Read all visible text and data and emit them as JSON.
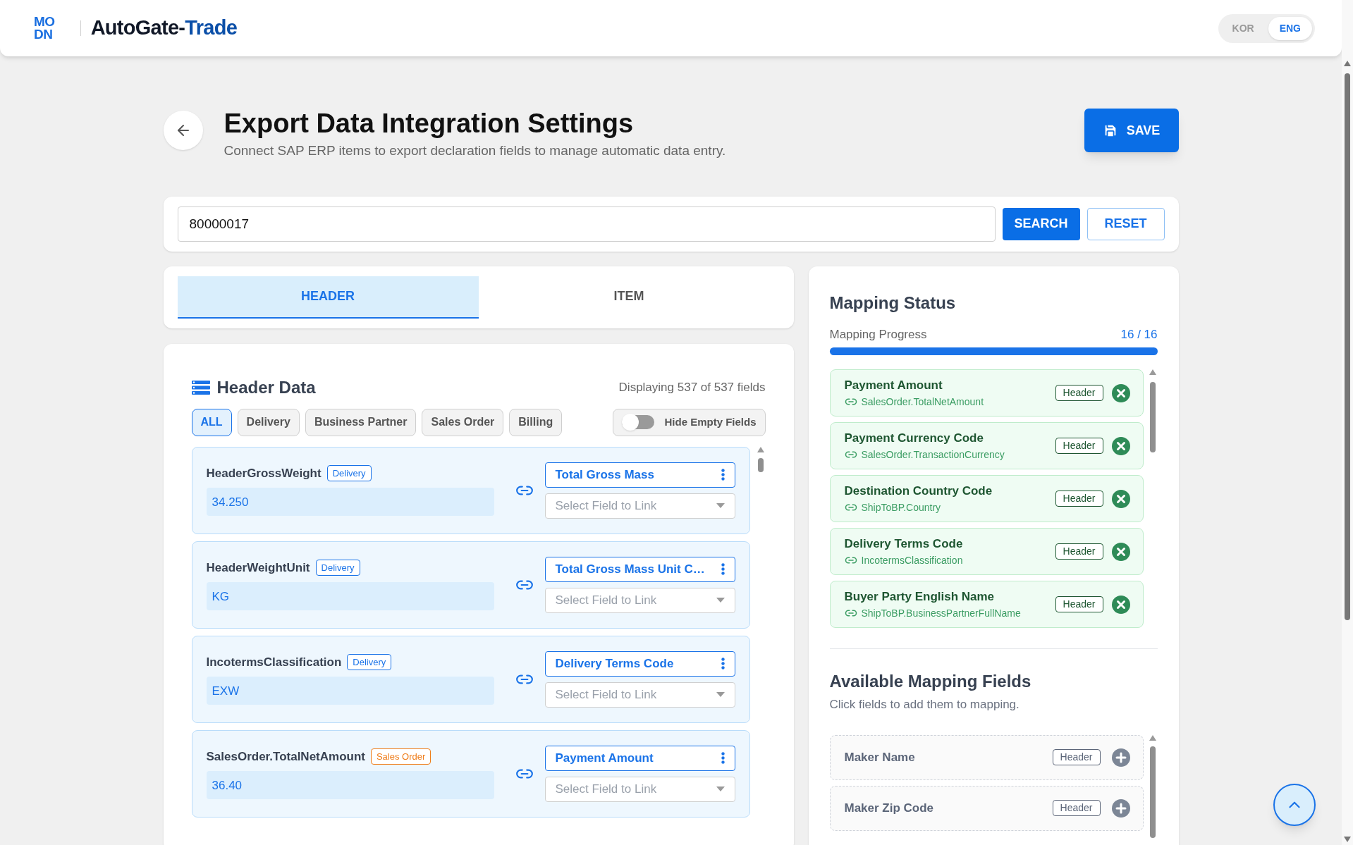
{
  "header": {
    "logo": [
      "MO",
      "DN"
    ],
    "app_name": "AutoGate-",
    "app_name_accent": "Trade",
    "languages": [
      {
        "label": "KOR",
        "selected": false
      },
      {
        "label": "ENG",
        "selected": true
      }
    ]
  },
  "page": {
    "title": "Export Data Integration Settings",
    "subtitle": "Connect SAP ERP items to export declaration fields to manage automatic data entry.",
    "save_button": "SAVE"
  },
  "search": {
    "value": "80000017",
    "search_button": "SEARCH",
    "reset_button": "RESET"
  },
  "tabs": [
    {
      "label": "HEADER",
      "selected": true
    },
    {
      "label": "ITEM",
      "selected": false
    }
  ],
  "header_data": {
    "title": "Header Data",
    "count": "Displaying 537 of 537 fields",
    "filters": [
      {
        "label": "ALL",
        "selected": true
      },
      {
        "label": "Delivery",
        "selected": false
      },
      {
        "label": "Business Partner",
        "selected": false
      },
      {
        "label": "Sales Order",
        "selected": false
      },
      {
        "label": "Billing",
        "selected": false
      }
    ],
    "hide_empty": {
      "label": "Hide Empty Fields",
      "on": false
    },
    "rows": [
      {
        "name": "HeaderGrossWeight",
        "category": "Delivery",
        "color": "#1a73e8",
        "value": "34.250",
        "mapped": "Total Gross Mass",
        "select_placeholder": "Select Field to Link"
      },
      {
        "name": "HeaderWeightUnit",
        "category": "Delivery",
        "color": "#1a73e8",
        "value": "KG",
        "mapped": "Total Gross Mass Unit C…",
        "select_placeholder": "Select Field to Link"
      },
      {
        "name": "IncotermsClassification",
        "category": "Delivery",
        "color": "#1a73e8",
        "value": "EXW",
        "mapped": "Delivery Terms Code",
        "select_placeholder": "Select Field to Link"
      },
      {
        "name": "SalesOrder.TotalNetAmount",
        "category": "Sales Order",
        "color": "#ef7d1a",
        "value": "36.40",
        "mapped": "Payment Amount",
        "select_placeholder": "Select Field to Link"
      }
    ]
  },
  "mapping_status": {
    "title": "Mapping Status",
    "progress_label": "Mapping Progress",
    "progress_text": "16 / 16",
    "level": 1,
    "mapped": [
      {
        "name": "Payment Amount",
        "source": "SalesOrder.TotalNetAmount",
        "tag": "Header"
      },
      {
        "name": "Payment Currency Code",
        "source": "SalesOrder.TransactionCurrency",
        "tag": "Header"
      },
      {
        "name": "Destination Country Code",
        "source": "ShipToBP.Country",
        "tag": "Header"
      },
      {
        "name": "Delivery Terms Code",
        "source": "IncotermsClassification",
        "tag": "Header"
      },
      {
        "name": "Buyer Party English Name",
        "source": "ShipToBP.BusinessPartnerFullName",
        "tag": "Header"
      }
    ]
  },
  "available": {
    "title": "Available Mapping Fields",
    "subtitle": "Click fields to add them to mapping.",
    "fields": [
      {
        "name": "Maker Name",
        "tag": "Header"
      },
      {
        "name": "Maker Zip Code",
        "tag": "Header"
      }
    ]
  }
}
